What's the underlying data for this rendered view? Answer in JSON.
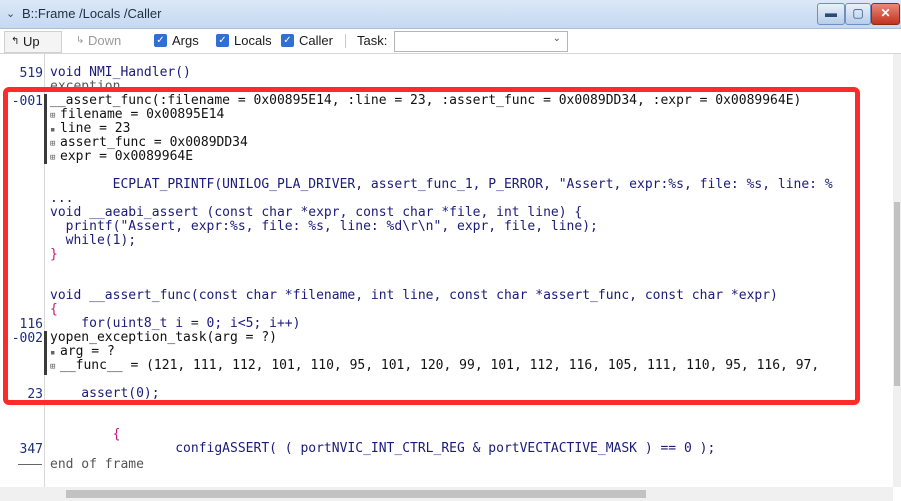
{
  "window": {
    "title": "B::Frame /Locals /Caller",
    "system_icon": "arrow-icon"
  },
  "toolbar": {
    "up_label": "Up",
    "down_label": "Down",
    "args_label": "Args",
    "locals_label": "Locals",
    "caller_label": "Caller",
    "task_label": "Task:",
    "task_value": ""
  },
  "lines": [
    {
      "num": "519",
      "text": "void NMI_Handler()"
    },
    {
      "num": "",
      "text": "exception"
    },
    {
      "num": "-001",
      "text": "__assert_func(:filename = 0x00895E14, :line = 23, :assert_func = 0x0089DD34, :expr = 0x0089964E)"
    },
    {
      "num": "",
      "text": "filename = 0x00895E14"
    },
    {
      "num": "",
      "text": "line = 23"
    },
    {
      "num": "",
      "text": "assert_func = 0x0089DD34"
    },
    {
      "num": "",
      "text": "expr = 0x0089964E"
    },
    {
      "num": "",
      "text": ""
    },
    {
      "num": "",
      "text": "        ECPLAT_PRINTF(UNILOG_PLA_DRIVER, assert_func_1, P_ERROR, \"Assert, expr:%s, file: %s, line: %"
    },
    {
      "num": "",
      "text": "..."
    },
    {
      "num": "",
      "text": "void __aeabi_assert (const char *expr, const char *file, int line) {"
    },
    {
      "num": "",
      "text": "  printf(\"Assert, expr:%s, file: %s, line: %d\\r\\n\", expr, file, line);"
    },
    {
      "num": "",
      "text": "  while(1);"
    },
    {
      "num": "",
      "text": "}"
    },
    {
      "num": "",
      "text": ""
    },
    {
      "num": "",
      "text": "void __assert_func(const char *filename, int line, const char *assert_func, const char *expr)"
    },
    {
      "num": "",
      "text": "{"
    },
    {
      "num": "116",
      "text": "    for(uint8_t i = 0; i<5; i++)"
    },
    {
      "num": "-002",
      "text": "yopen_exception_task(arg = ?)"
    },
    {
      "num": "",
      "text": "arg = ?"
    },
    {
      "num": "",
      "text": "__func__ = (121, 111, 112, 101, 110, 95, 101, 120, 99, 101, 112, 116, 105, 111, 110, 95, 116, 97,"
    },
    {
      "num": "23",
      "text": "    assert(0);"
    },
    {
      "num": "",
      "text": "        {"
    },
    {
      "num": "347",
      "text": "                configASSERT( ( portNVIC_INT_CTRL_REG & portVECTACTIVE_MASK ) == 0 );"
    },
    {
      "num": "",
      "text": "end of frame"
    }
  ]
}
